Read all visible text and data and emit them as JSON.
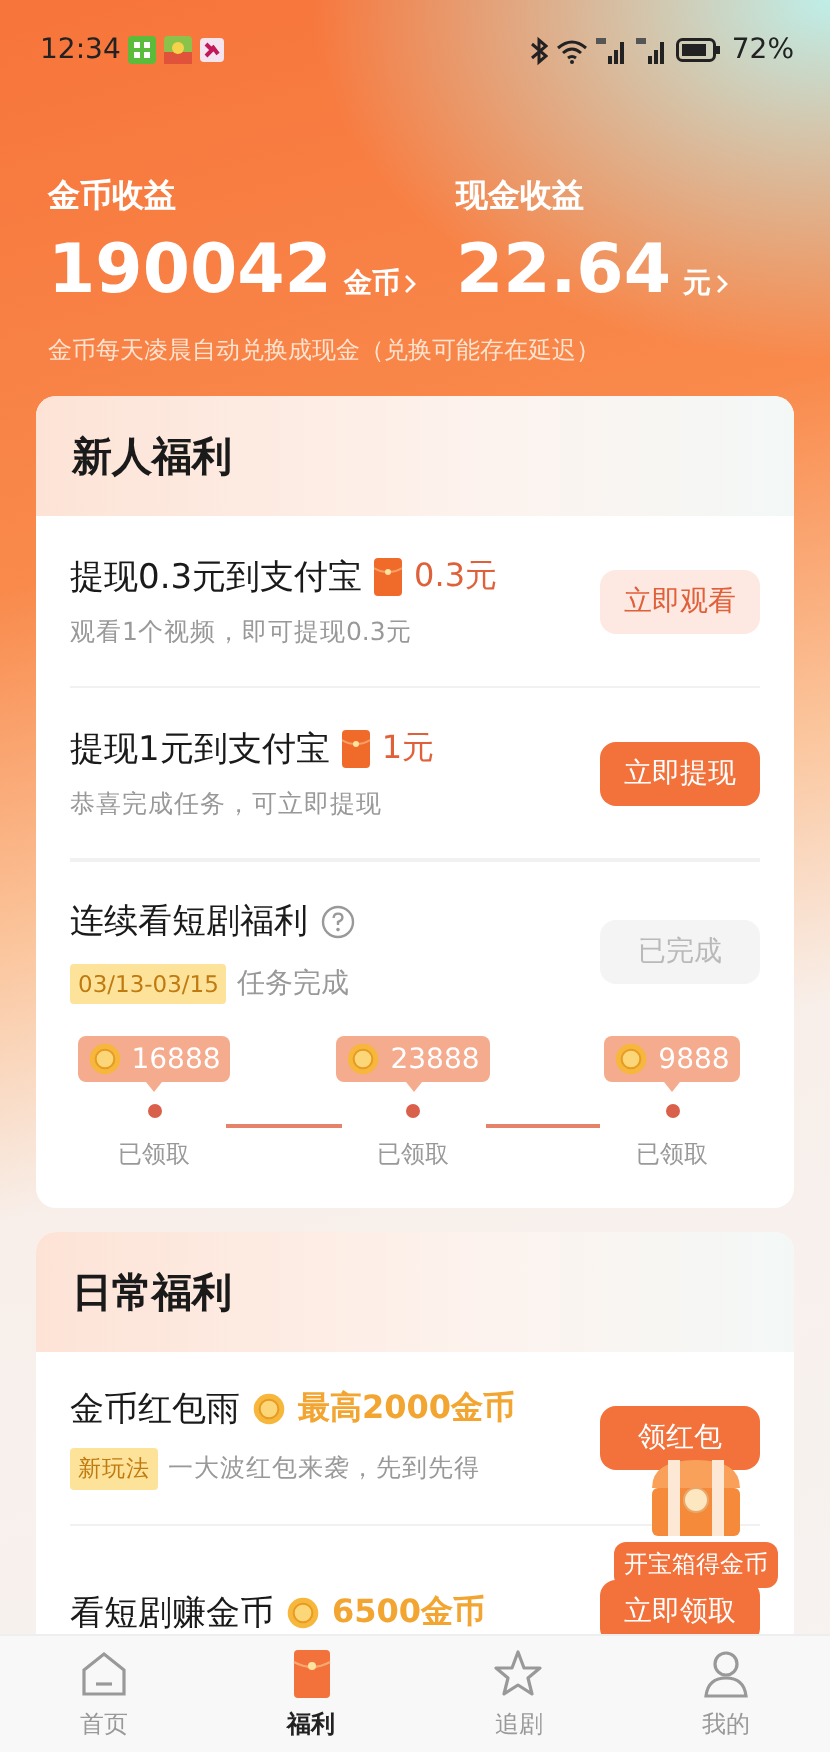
{
  "status_bar": {
    "time": "12:34",
    "battery": "72%"
  },
  "earnings": [
    {
      "label": "金币收益",
      "amount": "190042",
      "unit": "金币"
    },
    {
      "label": "现金收益",
      "amount": "22.64",
      "unit": "元"
    }
  ],
  "earnings_note": "金币每天凌晨自动兑换成现金（兑换可能存在延迟）",
  "newcomer": {
    "title": "新人福利",
    "tasks": [
      {
        "kind": "cash",
        "title": "提现0.3元到支付宝",
        "reward": "0.3元",
        "desc": "观看1个视频，即可提现0.3元",
        "button": {
          "label": "立即观看",
          "kind": "soft"
        }
      },
      {
        "kind": "cash",
        "title": "提现1元到支付宝",
        "reward": "1元",
        "desc": "恭喜完成任务，可立即提现",
        "button": {
          "label": "立即提现",
          "kind": "primary"
        }
      }
    ],
    "streak": {
      "title": "连续看短剧福利",
      "date_range": "03/13-03/15",
      "status": "任务完成",
      "button": {
        "label": "已完成",
        "kind": "done"
      },
      "milestones": [
        {
          "coins": "16888",
          "status": "已领取",
          "claimed": true
        },
        {
          "coins": "23888",
          "status": "已领取",
          "claimed": true
        },
        {
          "coins": "9888",
          "status": "已领取",
          "claimed": true
        }
      ]
    }
  },
  "daily": {
    "title": "日常福利",
    "tasks": [
      {
        "kind": "coin",
        "title": "金币红包雨",
        "reward": "最高2000金币",
        "tag": "新玩法",
        "desc": "一大波红包来袭，先到先得",
        "button": {
          "label": "领红包",
          "kind": "primary"
        }
      },
      {
        "kind": "coin",
        "title": "看短剧赚金币",
        "reward": "6500金币",
        "button": {
          "label": "立即领取",
          "kind": "primary"
        }
      }
    ]
  },
  "chest": {
    "label": "开宝箱得金币"
  },
  "tabs": [
    {
      "label": "首页",
      "selected": false
    },
    {
      "label": "福利",
      "selected": true
    },
    {
      "label": "追剧",
      "selected": false
    },
    {
      "label": "我的",
      "selected": false
    }
  ]
}
